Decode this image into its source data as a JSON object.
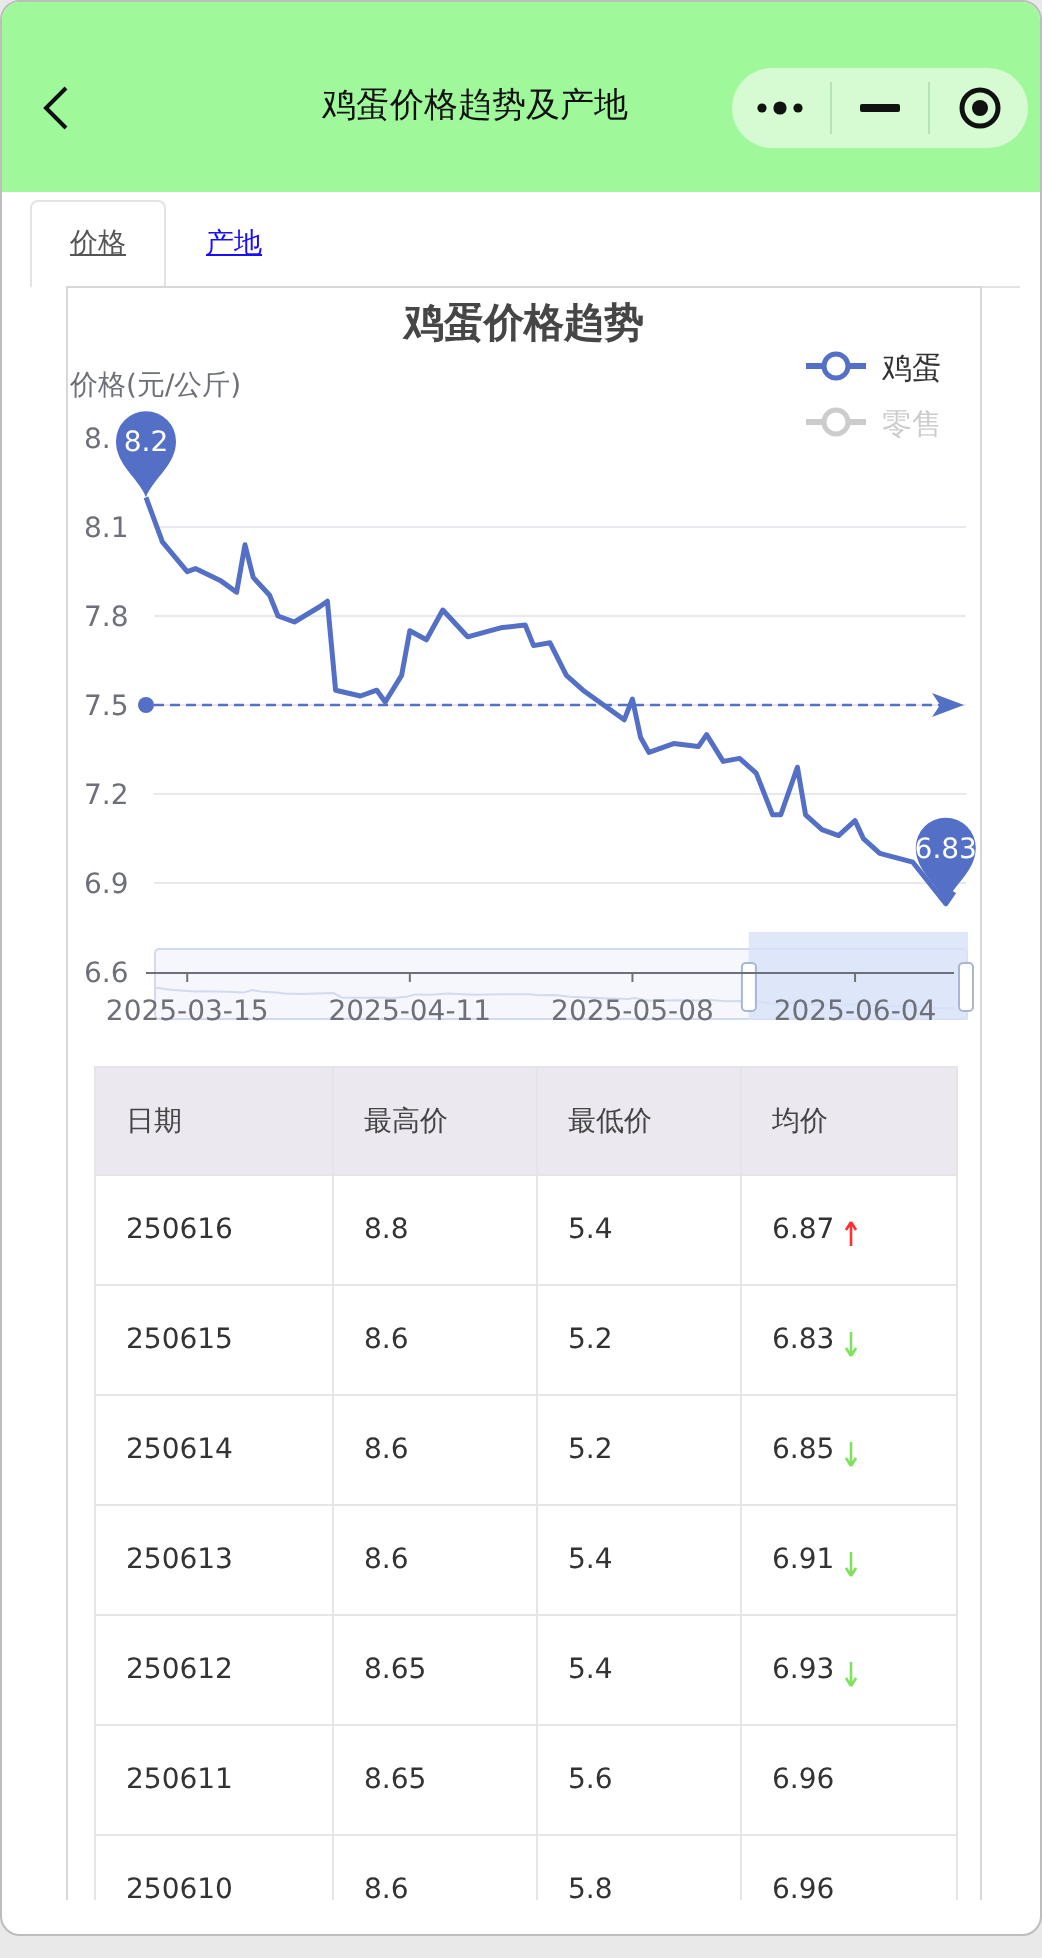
{
  "navbar": {
    "title": "鸡蛋价格趋势及产地"
  },
  "tabs": [
    {
      "label": "价格",
      "selected": true
    },
    {
      "label": "产地",
      "selected": false
    }
  ],
  "chart": {
    "legend": [
      {
        "selected": true
      },
      {
        "name": "零售",
        "selected": false
      }
    ],
    "chart_data": {
      "type": "line",
      "title": "鸡蛋价格趋势",
      "ylabel": "价格(元/公斤)",
      "x": [
        "2025-03-10",
        "2025-03-12",
        "2025-03-15",
        "2025-03-16",
        "2025-03-19",
        "2025-03-21",
        "2025-03-22",
        "2025-03-23",
        "2025-03-25",
        "2025-03-26",
        "2025-03-28",
        "2025-03-31",
        "2025-04-01",
        "2025-04-02",
        "2025-04-05",
        "2025-04-07",
        "2025-04-08",
        "2025-04-10",
        "2025-04-11",
        "2025-04-13",
        "2025-04-15",
        "2025-04-18",
        "2025-04-22",
        "2025-04-25",
        "2025-04-26",
        "2025-04-28",
        "2025-04-30",
        "2025-05-02",
        "2025-05-04",
        "2025-05-07",
        "2025-05-08",
        "2025-05-09",
        "2025-05-10",
        "2025-05-13",
        "2025-05-16",
        "2025-05-17",
        "2025-05-19",
        "2025-05-21",
        "2025-05-23",
        "2025-05-25",
        "2025-05-26",
        "2025-05-28",
        "2025-05-29",
        "2025-05-31",
        "2025-06-02",
        "2025-06-04",
        "2025-06-05",
        "2025-06-07",
        "2025-06-11",
        "2025-06-15",
        "2025-06-16"
      ],
      "series": [
        {
          "name": "鸡蛋",
          "color": "#5470c6",
          "values": [
            8.2,
            8.05,
            7.95,
            7.96,
            7.92,
            7.88,
            8.04,
            7.93,
            7.87,
            7.8,
            7.78,
            7.83,
            7.85,
            7.55,
            7.53,
            7.55,
            7.51,
            7.6,
            7.75,
            7.72,
            7.82,
            7.73,
            7.76,
            7.77,
            7.7,
            7.71,
            7.6,
            7.55,
            7.51,
            7.45,
            7.52,
            7.39,
            7.34,
            7.37,
            7.36,
            7.4,
            7.31,
            7.32,
            7.27,
            7.13,
            7.13,
            7.29,
            7.13,
            7.08,
            7.06,
            7.11,
            7.05,
            7.0,
            6.97,
            6.83,
            6.87
          ]
        }
      ],
      "xticks": [
        {
          "value": "2025-03-15",
          "label": "2025-03-15"
        },
        {
          "value": "2025-04-11",
          "label": "2025-04-11"
        },
        {
          "value": "2025-05-08",
          "label": "2025-05-08"
        },
        {
          "value": "2025-06-04",
          "label": "2025-06-04"
        }
      ],
      "xlim": [
        "2025-03-10",
        "2025-06-16"
      ],
      "ylim": [
        6.6,
        8.4
      ],
      "grid": true,
      "yticks": [
        6.6,
        6.9,
        7.2,
        7.5,
        7.8,
        8.1,
        {
          "value": 8.4,
          "label": "8."
        }
      ],
      "ref_lines": [
        {
          "axis": "y",
          "value": 7.5
        }
      ],
      "annotations": [
        {
          "text": "8.2",
          "x": "2025-03-10",
          "y": 8.2
        },
        {
          "text": "6.83",
          "x": "2025-06-15",
          "y": 6.83
        }
      ]
    },
    "range_slider": {
      "handles": [
        {
          "level": 0.73
        },
        {
          "level": 1
        }
      ]
    }
  },
  "table": {
    "columns": [
      "日期",
      "最高价",
      "最低价",
      "均价"
    ],
    "rows": [
      {
        "cells": [
          "250616",
          "8.8",
          "5.4",
          "6.87"
        ],
        "kind": "up"
      },
      {
        "cells": [
          "250615",
          "8.6",
          "5.2",
          "6.83"
        ],
        "kind": "down"
      },
      {
        "cells": [
          "250614",
          "8.6",
          "5.2",
          "6.85"
        ],
        "kind": "down"
      },
      {
        "cells": [
          "250613",
          "8.6",
          "5.4",
          "6.91"
        ],
        "kind": "down"
      },
      {
        "cells": [
          "250612",
          "8.65",
          "5.4",
          "6.93"
        ],
        "kind": "down"
      },
      {
        "cells": [
          "250611",
          "8.65",
          "5.6",
          "6.96"
        ],
        "kind": "plain"
      },
      {
        "cells": [
          "250610",
          "8.6",
          "5.8",
          "6.96"
        ],
        "kind": "plain"
      }
    ]
  }
}
